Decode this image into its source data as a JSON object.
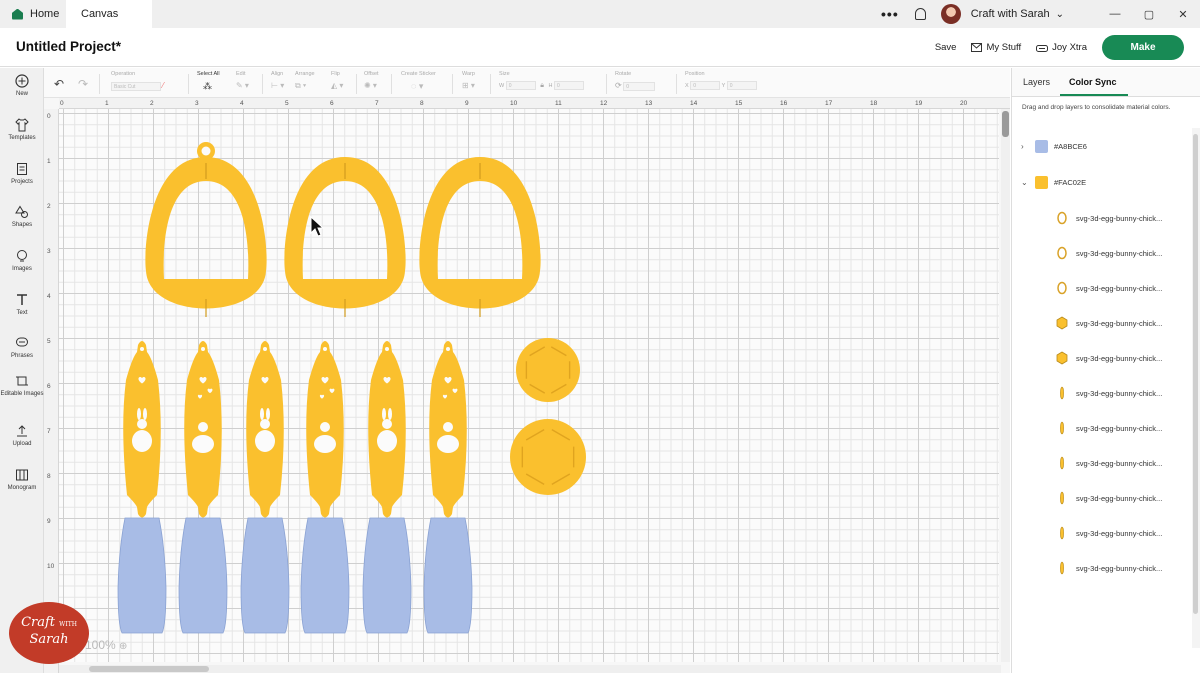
{
  "tabs": {
    "home": "Home",
    "canvas": "Canvas"
  },
  "titlebar": {
    "menu": "•••",
    "account": "Craft with Sarah",
    "chevron": "⌄",
    "win_min": "—",
    "win_max": "▢",
    "win_close": "✕"
  },
  "header": {
    "title": "Untitled Project*",
    "save": "Save",
    "my_stuff": "My Stuff",
    "joy_xtra": "Joy Xtra",
    "make": "Make"
  },
  "sidebar": [
    {
      "label": "New",
      "icon": "plus-circle-icon"
    },
    {
      "label": "Templates",
      "icon": "shirt-icon"
    },
    {
      "label": "Projects",
      "icon": "projects-icon"
    },
    {
      "label": "Shapes",
      "icon": "shapes-icon"
    },
    {
      "label": "Images",
      "icon": "lightbulb-icon"
    },
    {
      "label": "Text",
      "icon": "text-icon"
    },
    {
      "label": "Phrases",
      "icon": "speech-bubble-icon"
    },
    {
      "label": "Editable Images",
      "icon": "crop-icon"
    },
    {
      "label": "Upload",
      "icon": "upload-icon"
    },
    {
      "label": "Monogram",
      "icon": "monogram-icon"
    }
  ],
  "toolbar": {
    "operation": "Operation",
    "operation_value": "Basic Cut",
    "select_all": "Select All",
    "edit": "Edit",
    "align": "Align",
    "arrange": "Arrange",
    "flip": "Flip",
    "offset": "Offset",
    "create_sticker": "Create Sticker",
    "warp": "Warp",
    "size": "Size",
    "size_w": "W",
    "size_w_value": "0",
    "size_h": "H",
    "size_h_value": "0",
    "rotate": "Rotate",
    "rotate_value": "0",
    "position": "Position",
    "pos_x": "X",
    "pos_x_value": "0",
    "pos_y": "Y",
    "pos_y_value": "0"
  },
  "ruler": {
    "top": [
      "0",
      "1",
      "2",
      "3",
      "4",
      "5",
      "6",
      "7",
      "8",
      "9",
      "10",
      "11",
      "12",
      "13",
      "14",
      "15",
      "16",
      "17",
      "18",
      "19",
      "20"
    ],
    "left": [
      "0",
      "1",
      "2",
      "3",
      "4",
      "5",
      "6",
      "7",
      "8",
      "9",
      "10"
    ]
  },
  "canvas": {
    "zoom": "100%",
    "logo_line1": "Craft",
    "logo_small": "WITH",
    "logo_line2": "Sarah"
  },
  "colors": {
    "blue": "#A8BCE6",
    "yellow": "#FAC02E",
    "accent": "#188a55"
  },
  "panel": {
    "tab_layers": "Layers",
    "tab_color_sync": "Color Sync",
    "description": "Drag and drop layers to consolidate material colors.",
    "groups": [
      {
        "hex": "#A8BCE6",
        "expanded": false,
        "caret": "›"
      },
      {
        "hex": "#FAC02E",
        "expanded": true,
        "caret": "⌄"
      }
    ],
    "layers": [
      {
        "name": "svg-3d-egg-bunny-chick...",
        "icon": "egg-outline-icon"
      },
      {
        "name": "svg-3d-egg-bunny-chick...",
        "icon": "egg-outline-icon"
      },
      {
        "name": "svg-3d-egg-bunny-chick...",
        "icon": "egg-outline-icon"
      },
      {
        "name": "svg-3d-egg-bunny-chick...",
        "icon": "hexagon-icon"
      },
      {
        "name": "svg-3d-egg-bunny-chick...",
        "icon": "hexagon-icon"
      },
      {
        "name": "svg-3d-egg-bunny-chick...",
        "icon": "slim-strip-icon"
      },
      {
        "name": "svg-3d-egg-bunny-chick...",
        "icon": "slim-strip-icon"
      },
      {
        "name": "svg-3d-egg-bunny-chick...",
        "icon": "slim-strip-icon"
      },
      {
        "name": "svg-3d-egg-bunny-chick...",
        "icon": "slim-strip-icon"
      },
      {
        "name": "svg-3d-egg-bunny-chick...",
        "icon": "slim-strip-icon"
      },
      {
        "name": "svg-3d-egg-bunny-chick...",
        "icon": "slim-strip-icon"
      }
    ]
  }
}
